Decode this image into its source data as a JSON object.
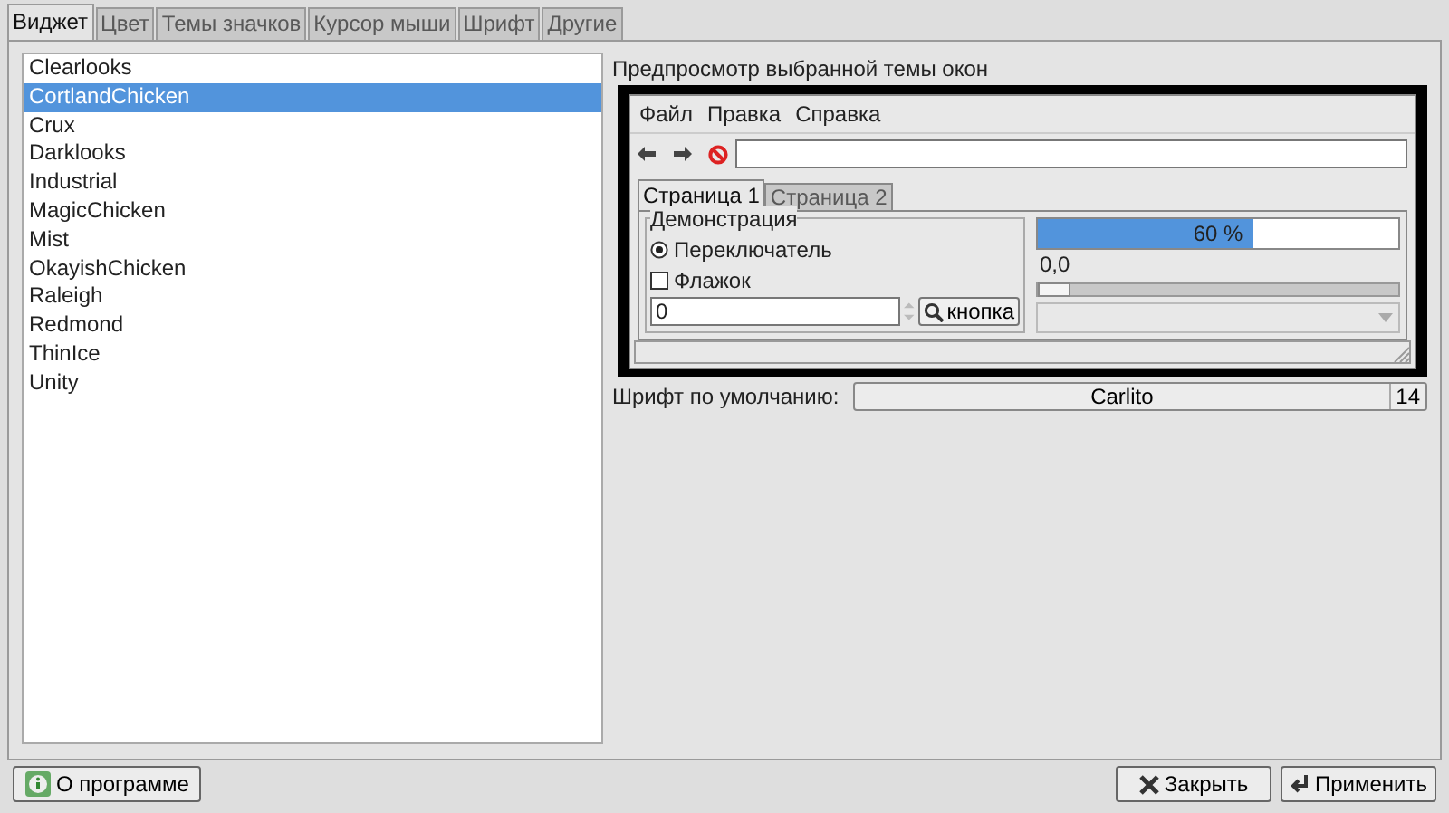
{
  "tabs": [
    {
      "label": "Виджет",
      "selected": true
    },
    {
      "label": "Цвет",
      "selected": false
    },
    {
      "label": "Темы значков",
      "selected": false
    },
    {
      "label": "Курсор мыши",
      "selected": false
    },
    {
      "label": "Шрифт",
      "selected": false
    },
    {
      "label": "Другие",
      "selected": false
    }
  ],
  "themes": [
    {
      "name": "Clearlooks",
      "selected": false
    },
    {
      "name": "CortlandChicken",
      "selected": true
    },
    {
      "name": "Crux",
      "selected": false
    },
    {
      "name": "Darklooks",
      "selected": false
    },
    {
      "name": "Industrial",
      "selected": false
    },
    {
      "name": "MagicChicken",
      "selected": false
    },
    {
      "name": "Mist",
      "selected": false
    },
    {
      "name": "OkayishChicken",
      "selected": false
    },
    {
      "name": "Raleigh",
      "selected": false
    },
    {
      "name": "Redmond",
      "selected": false
    },
    {
      "name": "ThinIce",
      "selected": false
    },
    {
      "name": "Unity",
      "selected": false
    }
  ],
  "preview": {
    "title": "Предпросмотр выбранной темы окон",
    "menu": [
      "Файл",
      "Правка",
      "Справка"
    ],
    "tabs": [
      {
        "label": "Страница 1",
        "selected": true
      },
      {
        "label": "Страница 2",
        "selected": false
      }
    ],
    "group_title": "Демонстрация",
    "radio": {
      "label": "Переключатель",
      "selected": true
    },
    "checkbox": {
      "label": "Флажок",
      "checked": false
    },
    "spin_value": "0",
    "button": "кнопка",
    "progress": {
      "level": 0.6,
      "text": "60 %"
    },
    "scale": {
      "reading": "0,0",
      "level": 0
    }
  },
  "font": {
    "label": "Шрифт по умолчанию:",
    "name": "Carlito",
    "size": "14"
  },
  "buttons": [
    {
      "kind": "about",
      "label": "О программе"
    },
    {
      "kind": "close",
      "label": "Закрыть"
    },
    {
      "kind": "apply",
      "label": "Применить"
    }
  ]
}
